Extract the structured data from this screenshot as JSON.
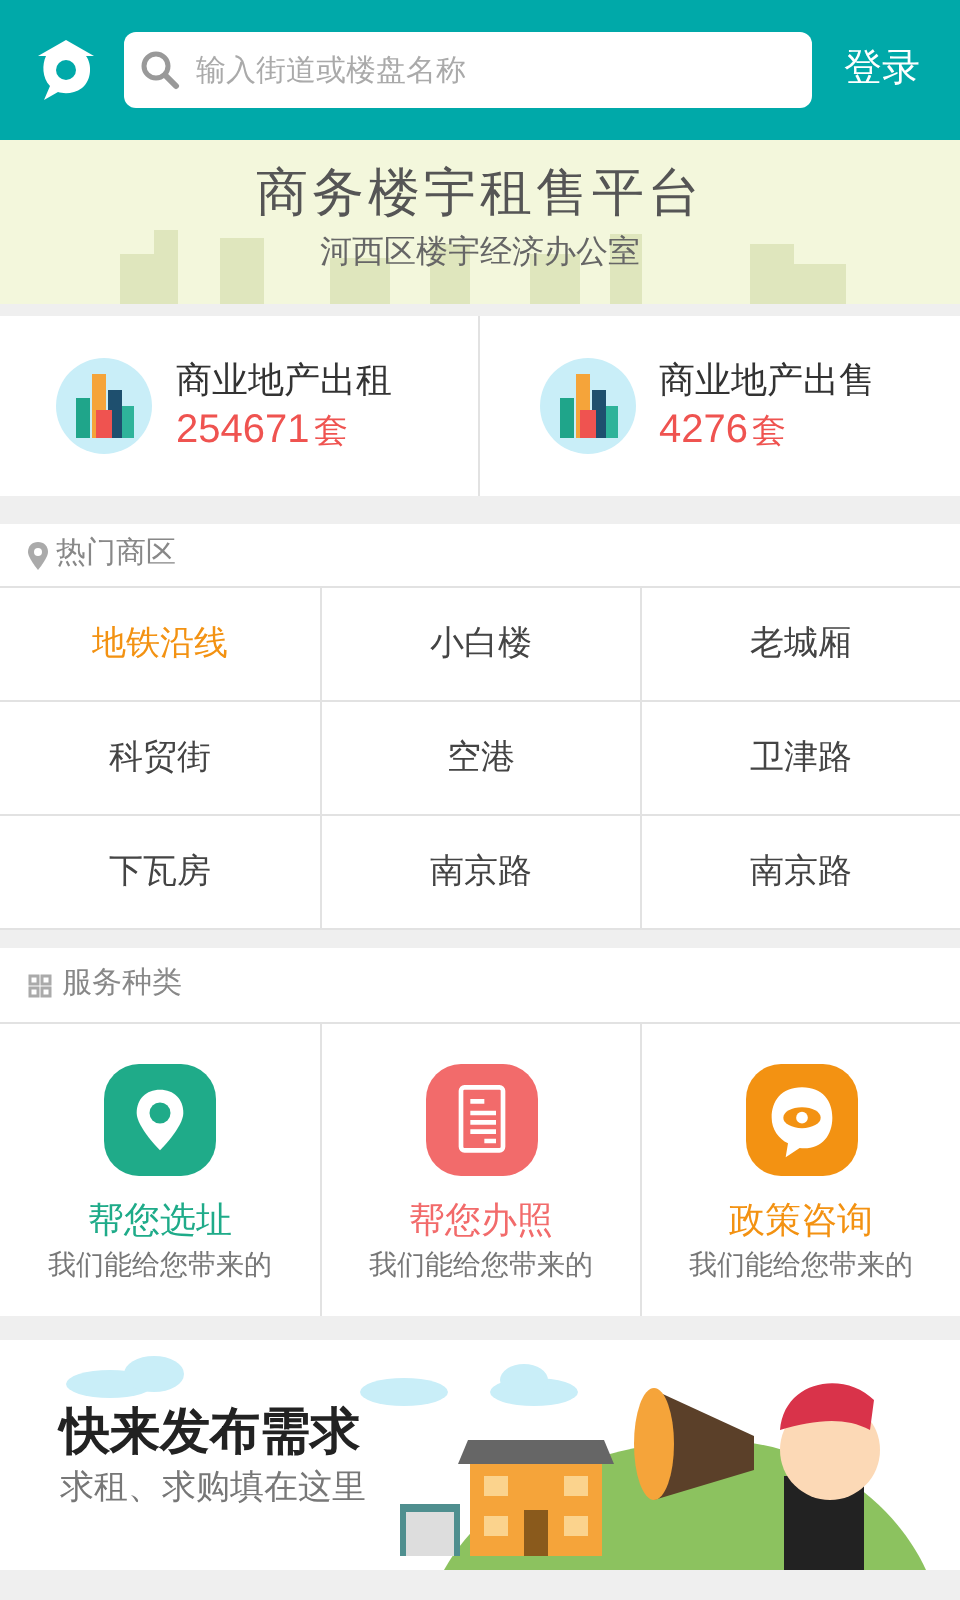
{
  "header": {
    "search": {
      "placeholder": "输入街道或楼盘名称"
    },
    "login": "登录"
  },
  "banner": {
    "title": "商务楼宇租售平台",
    "subtitle": "河西区楼宇经济办公室"
  },
  "stats": [
    {
      "label": "商业地产出租",
      "count": "254671",
      "unit": "套"
    },
    {
      "label": "商业地产出售",
      "count": "4276",
      "unit": "套"
    }
  ],
  "hot_areas": {
    "title": "热门商区",
    "items": [
      {
        "label": "地铁沿线",
        "selected": true
      },
      {
        "label": "小白楼",
        "selected": false
      },
      {
        "label": "老城厢",
        "selected": false
      },
      {
        "label": "科贸街",
        "selected": false
      },
      {
        "label": "空港",
        "selected": false
      },
      {
        "label": "卫津路",
        "selected": false
      },
      {
        "label": "下瓦房",
        "selected": false
      },
      {
        "label": "南京路",
        "selected": false
      },
      {
        "label": "南京路",
        "selected": false
      }
    ]
  },
  "services": {
    "title": "服务种类",
    "items": [
      {
        "kind": "location",
        "title": "帮您选址",
        "desc": "我们能给您带来的",
        "color": "#1fab89"
      },
      {
        "kind": "document",
        "title": "帮您办照",
        "desc": "我们能给您带来的",
        "color": "#f26b6b"
      },
      {
        "kind": "consult",
        "title": "政策咨询",
        "desc": "我们能给您带来的",
        "color": "#f39212"
      }
    ]
  },
  "promo": {
    "title": "快来发布需求",
    "subtitle": "求租、求购填在这里"
  }
}
